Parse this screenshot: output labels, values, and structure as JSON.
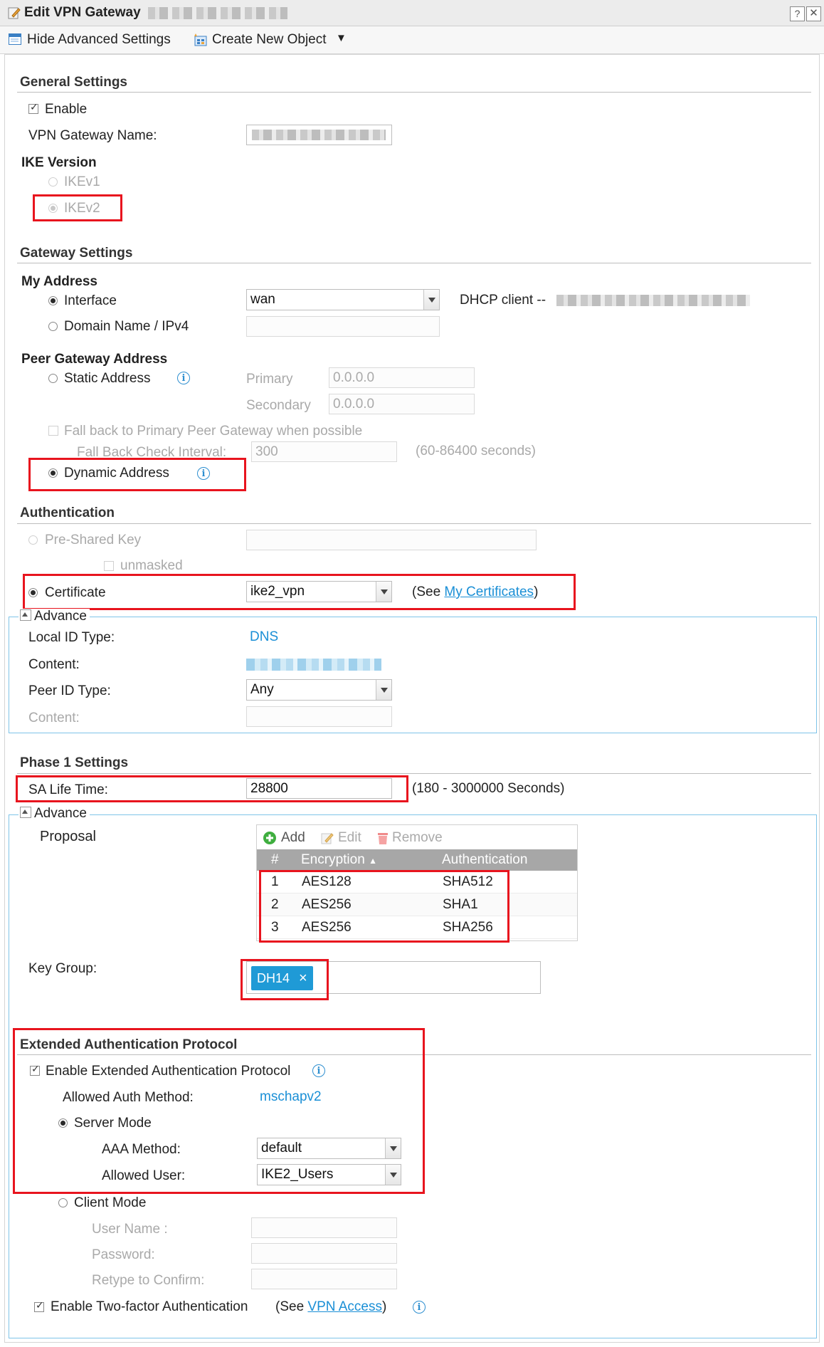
{
  "window": {
    "title": "Edit VPN Gateway"
  },
  "toolbar": {
    "hide_advanced": "Hide Advanced Settings",
    "create_new": "Create New Object"
  },
  "general": {
    "heading": "General Settings",
    "enable_label": "Enable",
    "enable_checked": true,
    "name_label": "VPN Gateway Name:",
    "ike_heading": "IKE Version",
    "ikev1": "IKEv1",
    "ikev2": "IKEv2"
  },
  "gateway": {
    "heading": "Gateway Settings",
    "my_address": "My Address",
    "interface_label": "Interface",
    "interface_value": "wan",
    "dhcp_label": "DHCP client --",
    "domain_label": "Domain Name / IPv4",
    "peer_heading": "Peer Gateway Address",
    "static_label": "Static Address",
    "primary_label": "Primary",
    "primary_value": "0.0.0.0",
    "secondary_label": "Secondary",
    "secondary_value": "0.0.0.0",
    "fallback_label": "Fall back to Primary Peer Gateway when possible",
    "fallback_interval_label": "Fall Back Check Interval:",
    "fallback_interval_value": "300",
    "fallback_range": "(60-86400 seconds)",
    "dynamic_label": "Dynamic Address"
  },
  "auth": {
    "heading": "Authentication",
    "psk_label": "Pre-Shared Key",
    "unmasked_label": "unmasked",
    "cert_label": "Certificate",
    "cert_value": "ike2_vpn",
    "see_prefix": "(See",
    "see_link": "My Certificates",
    "see_suffix": ")",
    "advance_label": "Advance",
    "local_id_label": "Local ID Type:",
    "local_id_value": "DNS",
    "content_label": "Content:",
    "peer_id_label": "Peer ID Type:",
    "peer_id_value": "Any",
    "content2_label": "Content:"
  },
  "phase1": {
    "heading": "Phase 1 Settings",
    "sa_label": "SA Life Time:",
    "sa_value": "28800",
    "sa_range": "(180 - 3000000 Seconds)",
    "advance_label": "Advance",
    "proposal_label": "Proposal",
    "add": "Add",
    "edit": "Edit",
    "remove": "Remove",
    "columns": [
      "#",
      "Encryption",
      "Authentication"
    ],
    "rows": [
      {
        "n": "1",
        "enc": "AES128",
        "auth": "SHA512"
      },
      {
        "n": "2",
        "enc": "AES256",
        "auth": "SHA1"
      },
      {
        "n": "3",
        "enc": "AES256",
        "auth": "SHA256"
      }
    ],
    "key_group_label": "Key Group:",
    "key_group_tag": "DH14",
    "tag_close": "×"
  },
  "xauth": {
    "heading": "Extended Authentication Protocol",
    "enable_label": "Enable Extended Authentication Protocol",
    "allowed_method_label": "Allowed Auth Method:",
    "allowed_method_value": "mschapv2",
    "server_mode": "Server Mode",
    "aaa_label": "AAA Method:",
    "aaa_value": "default",
    "allowed_user_label": "Allowed User:",
    "allowed_user_value": "IKE2_Users",
    "client_mode": "Client Mode",
    "user_name_label": "User Name :",
    "password_label": "Password:",
    "retype_label": "Retype to Confirm:",
    "twofactor_label": "Enable Two-factor Authentication",
    "see_prefix": "(See",
    "see_link": "VPN Access",
    "see_suffix": ")"
  },
  "colors": {
    "accent": "#1a8fd6",
    "highlight": "#e8141e",
    "table_header": "#a7a7a7",
    "tag": "#1f9ad6"
  },
  "icons": {
    "title": "edit-icon",
    "hide": "settings-window-icon",
    "create": "create-object-icon",
    "info": "info-icon",
    "add": "add-icon",
    "edit": "pencil-icon",
    "remove": "trash-icon"
  }
}
